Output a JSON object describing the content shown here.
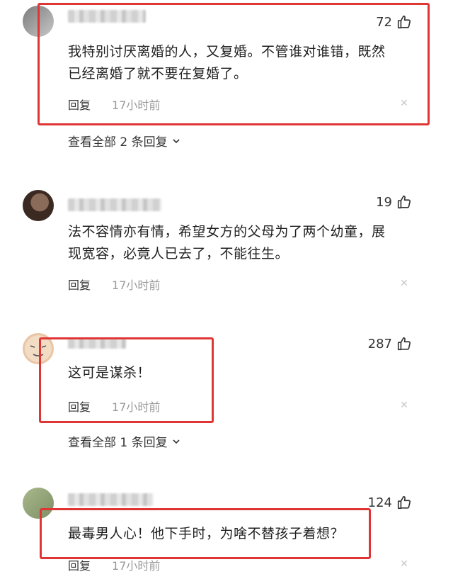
{
  "comments": [
    {
      "likes": "72",
      "text_line1": "我特别讨厌离婚的人，又复婚。不管谁对谁错，既然",
      "text_line2": "已经离婚了就不要在复婚了。",
      "reply_label": "回复",
      "time": "17小时前",
      "view_all": "查看全部 2 条回复"
    },
    {
      "likes": "19",
      "text_line1": "法不容情亦有情，希望女方的父母为了两个幼童，展",
      "text_line2": "现宽容，必竟人已去了，不能往生。",
      "reply_label": "回复",
      "time": "17小时前"
    },
    {
      "likes": "287",
      "text_line1": "这可是谋杀！",
      "reply_label": "回复",
      "time": "17小时前",
      "view_all": "查看全部 1 条回复"
    },
    {
      "likes": "124",
      "text_line1": "最毒男人心！他下手时，为啥不替孩子着想？",
      "reply_label": "回复",
      "time": "17小时前"
    }
  ],
  "colors": {
    "highlight_box": "#e03535",
    "time_text": "#9a9a9a"
  },
  "icons": {
    "like": "thumbs-up-icon",
    "close": "close-icon",
    "expand": "chevron-down-icon"
  }
}
